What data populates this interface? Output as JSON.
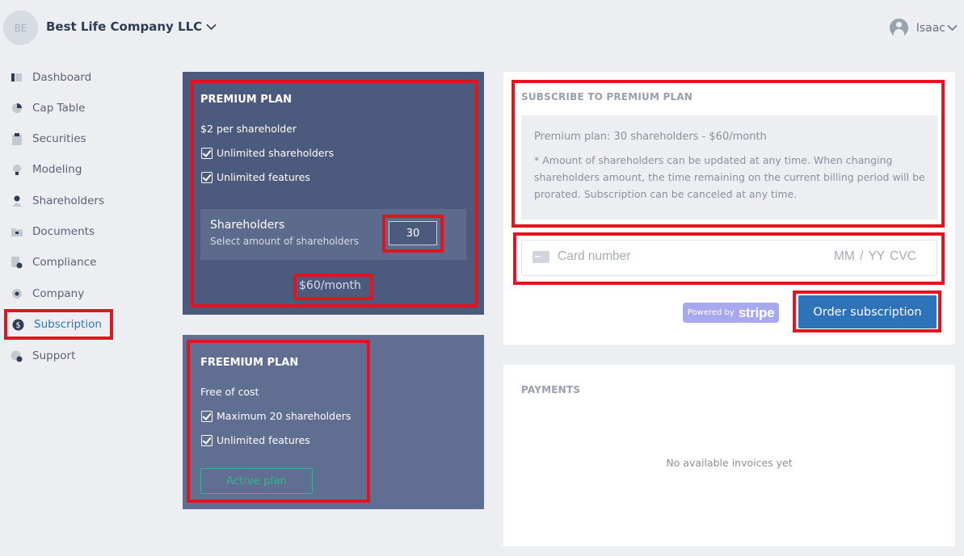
{
  "header": {
    "company_initials": "BE",
    "company_name": "Best Life Company LLC",
    "user_name": "Isaac"
  },
  "sidebar": {
    "items": [
      {
        "label": "Dashboard",
        "icon": "dashboard-icon"
      },
      {
        "label": "Cap Table",
        "icon": "pie-chart-icon"
      },
      {
        "label": "Securities",
        "icon": "clipboard-icon"
      },
      {
        "label": "Modeling",
        "icon": "lightbulb-icon"
      },
      {
        "label": "Shareholders",
        "icon": "person-icon"
      },
      {
        "label": "Documents",
        "icon": "folder-icon"
      },
      {
        "label": "Compliance",
        "icon": "document-icon"
      },
      {
        "label": "Company",
        "icon": "gear-icon"
      },
      {
        "label": "Subscription",
        "icon": "dollar-icon",
        "active": true
      },
      {
        "label": "Support",
        "icon": "support-icon"
      }
    ]
  },
  "premium_plan": {
    "title": "PREMIUM PLAN",
    "price_line": "$2 per shareholder",
    "features": [
      "Unlimited shareholders",
      "Unlimited features"
    ],
    "shareholders_label": "Shareholders",
    "shareholders_sub": "Select amount of shareholders",
    "shareholders_value": "30",
    "total": "$60/month"
  },
  "freemium_plan": {
    "title": "FREEMIUM PLAN",
    "price_line": "Free of cost",
    "features": [
      "Maximum 20 shareholders",
      "Unlimited features"
    ],
    "status_button": "Active plan"
  },
  "subscribe": {
    "heading": "SUBSCRIBE TO PREMIUM PLAN",
    "summary": "Premium plan: 30 shareholders - $60/month",
    "note": "* Amount of shareholders can be updated at any time. When changing shareholders amount, the time remaining on the current billing period will be prorated. Subscription can be canceled at any time.",
    "card_placeholder": "Card number",
    "expiry_cvc_placeholder": "MM / YY  CVC",
    "powered_by": "Powered by",
    "stripe": "stripe",
    "order_button": "Order subscription"
  },
  "payments": {
    "heading": "PAYMENTS",
    "empty_message": "No available invoices yet"
  },
  "colors": {
    "accent": "#2e72b8",
    "highlight_border": "#e0151f",
    "premium_bg": "#4c5a7d",
    "freemium_bg": "#606e91",
    "active_green": "#36b392"
  }
}
